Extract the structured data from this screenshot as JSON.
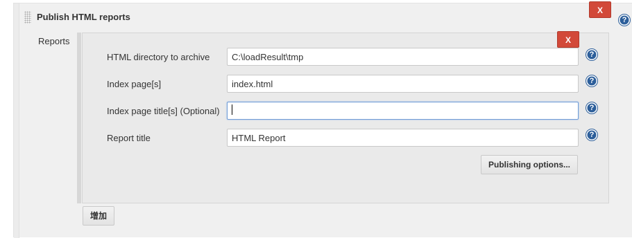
{
  "section": {
    "title": "Publish HTML reports",
    "delete_label": "X",
    "help_glyph": "?"
  },
  "reports": {
    "label": "Reports",
    "delete_label": "X",
    "fields": [
      {
        "label": "HTML directory to archive",
        "value": "C:\\loadResult\\tmp"
      },
      {
        "label": "Index page[s]",
        "value": "index.html"
      },
      {
        "label": "Index page title[s] (Optional)",
        "value": ""
      },
      {
        "label": "Report title",
        "value": "HTML Report"
      }
    ],
    "publishing_options_label": "Publishing options...",
    "add_label": "增加"
  },
  "colors": {
    "delete_button": "#d24939",
    "help_icon": "#2c5e9a",
    "focus_border": "#6f9bd6"
  },
  "icons": [
    "drag-handle-icon",
    "help-icon",
    "delete-icon"
  ]
}
